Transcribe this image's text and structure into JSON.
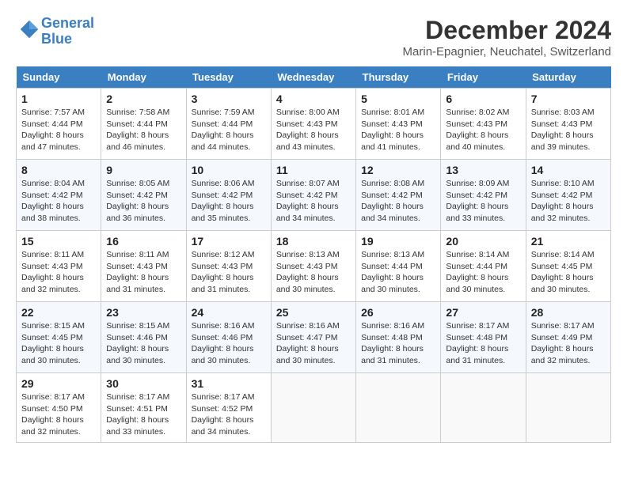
{
  "header": {
    "logo_line1": "General",
    "logo_line2": "Blue",
    "month": "December 2024",
    "location": "Marin-Epagnier, Neuchatel, Switzerland"
  },
  "days_of_week": [
    "Sunday",
    "Monday",
    "Tuesday",
    "Wednesday",
    "Thursday",
    "Friday",
    "Saturday"
  ],
  "weeks": [
    [
      {
        "day": "1",
        "info": "Sunrise: 7:57 AM\nSunset: 4:44 PM\nDaylight: 8 hours and 47 minutes."
      },
      {
        "day": "2",
        "info": "Sunrise: 7:58 AM\nSunset: 4:44 PM\nDaylight: 8 hours and 46 minutes."
      },
      {
        "day": "3",
        "info": "Sunrise: 7:59 AM\nSunset: 4:44 PM\nDaylight: 8 hours and 44 minutes."
      },
      {
        "day": "4",
        "info": "Sunrise: 8:00 AM\nSunset: 4:43 PM\nDaylight: 8 hours and 43 minutes."
      },
      {
        "day": "5",
        "info": "Sunrise: 8:01 AM\nSunset: 4:43 PM\nDaylight: 8 hours and 41 minutes."
      },
      {
        "day": "6",
        "info": "Sunrise: 8:02 AM\nSunset: 4:43 PM\nDaylight: 8 hours and 40 minutes."
      },
      {
        "day": "7",
        "info": "Sunrise: 8:03 AM\nSunset: 4:43 PM\nDaylight: 8 hours and 39 minutes."
      }
    ],
    [
      {
        "day": "8",
        "info": "Sunrise: 8:04 AM\nSunset: 4:42 PM\nDaylight: 8 hours and 38 minutes."
      },
      {
        "day": "9",
        "info": "Sunrise: 8:05 AM\nSunset: 4:42 PM\nDaylight: 8 hours and 36 minutes."
      },
      {
        "day": "10",
        "info": "Sunrise: 8:06 AM\nSunset: 4:42 PM\nDaylight: 8 hours and 35 minutes."
      },
      {
        "day": "11",
        "info": "Sunrise: 8:07 AM\nSunset: 4:42 PM\nDaylight: 8 hours and 34 minutes."
      },
      {
        "day": "12",
        "info": "Sunrise: 8:08 AM\nSunset: 4:42 PM\nDaylight: 8 hours and 34 minutes."
      },
      {
        "day": "13",
        "info": "Sunrise: 8:09 AM\nSunset: 4:42 PM\nDaylight: 8 hours and 33 minutes."
      },
      {
        "day": "14",
        "info": "Sunrise: 8:10 AM\nSunset: 4:42 PM\nDaylight: 8 hours and 32 minutes."
      }
    ],
    [
      {
        "day": "15",
        "info": "Sunrise: 8:11 AM\nSunset: 4:43 PM\nDaylight: 8 hours and 32 minutes."
      },
      {
        "day": "16",
        "info": "Sunrise: 8:11 AM\nSunset: 4:43 PM\nDaylight: 8 hours and 31 minutes."
      },
      {
        "day": "17",
        "info": "Sunrise: 8:12 AM\nSunset: 4:43 PM\nDaylight: 8 hours and 31 minutes."
      },
      {
        "day": "18",
        "info": "Sunrise: 8:13 AM\nSunset: 4:43 PM\nDaylight: 8 hours and 30 minutes."
      },
      {
        "day": "19",
        "info": "Sunrise: 8:13 AM\nSunset: 4:44 PM\nDaylight: 8 hours and 30 minutes."
      },
      {
        "day": "20",
        "info": "Sunrise: 8:14 AM\nSunset: 4:44 PM\nDaylight: 8 hours and 30 minutes."
      },
      {
        "day": "21",
        "info": "Sunrise: 8:14 AM\nSunset: 4:45 PM\nDaylight: 8 hours and 30 minutes."
      }
    ],
    [
      {
        "day": "22",
        "info": "Sunrise: 8:15 AM\nSunset: 4:45 PM\nDaylight: 8 hours and 30 minutes."
      },
      {
        "day": "23",
        "info": "Sunrise: 8:15 AM\nSunset: 4:46 PM\nDaylight: 8 hours and 30 minutes."
      },
      {
        "day": "24",
        "info": "Sunrise: 8:16 AM\nSunset: 4:46 PM\nDaylight: 8 hours and 30 minutes."
      },
      {
        "day": "25",
        "info": "Sunrise: 8:16 AM\nSunset: 4:47 PM\nDaylight: 8 hours and 30 minutes."
      },
      {
        "day": "26",
        "info": "Sunrise: 8:16 AM\nSunset: 4:48 PM\nDaylight: 8 hours and 31 minutes."
      },
      {
        "day": "27",
        "info": "Sunrise: 8:17 AM\nSunset: 4:48 PM\nDaylight: 8 hours and 31 minutes."
      },
      {
        "day": "28",
        "info": "Sunrise: 8:17 AM\nSunset: 4:49 PM\nDaylight: 8 hours and 32 minutes."
      }
    ],
    [
      {
        "day": "29",
        "info": "Sunrise: 8:17 AM\nSunset: 4:50 PM\nDaylight: 8 hours and 32 minutes."
      },
      {
        "day": "30",
        "info": "Sunrise: 8:17 AM\nSunset: 4:51 PM\nDaylight: 8 hours and 33 minutes."
      },
      {
        "day": "31",
        "info": "Sunrise: 8:17 AM\nSunset: 4:52 PM\nDaylight: 8 hours and 34 minutes."
      },
      null,
      null,
      null,
      null
    ]
  ]
}
